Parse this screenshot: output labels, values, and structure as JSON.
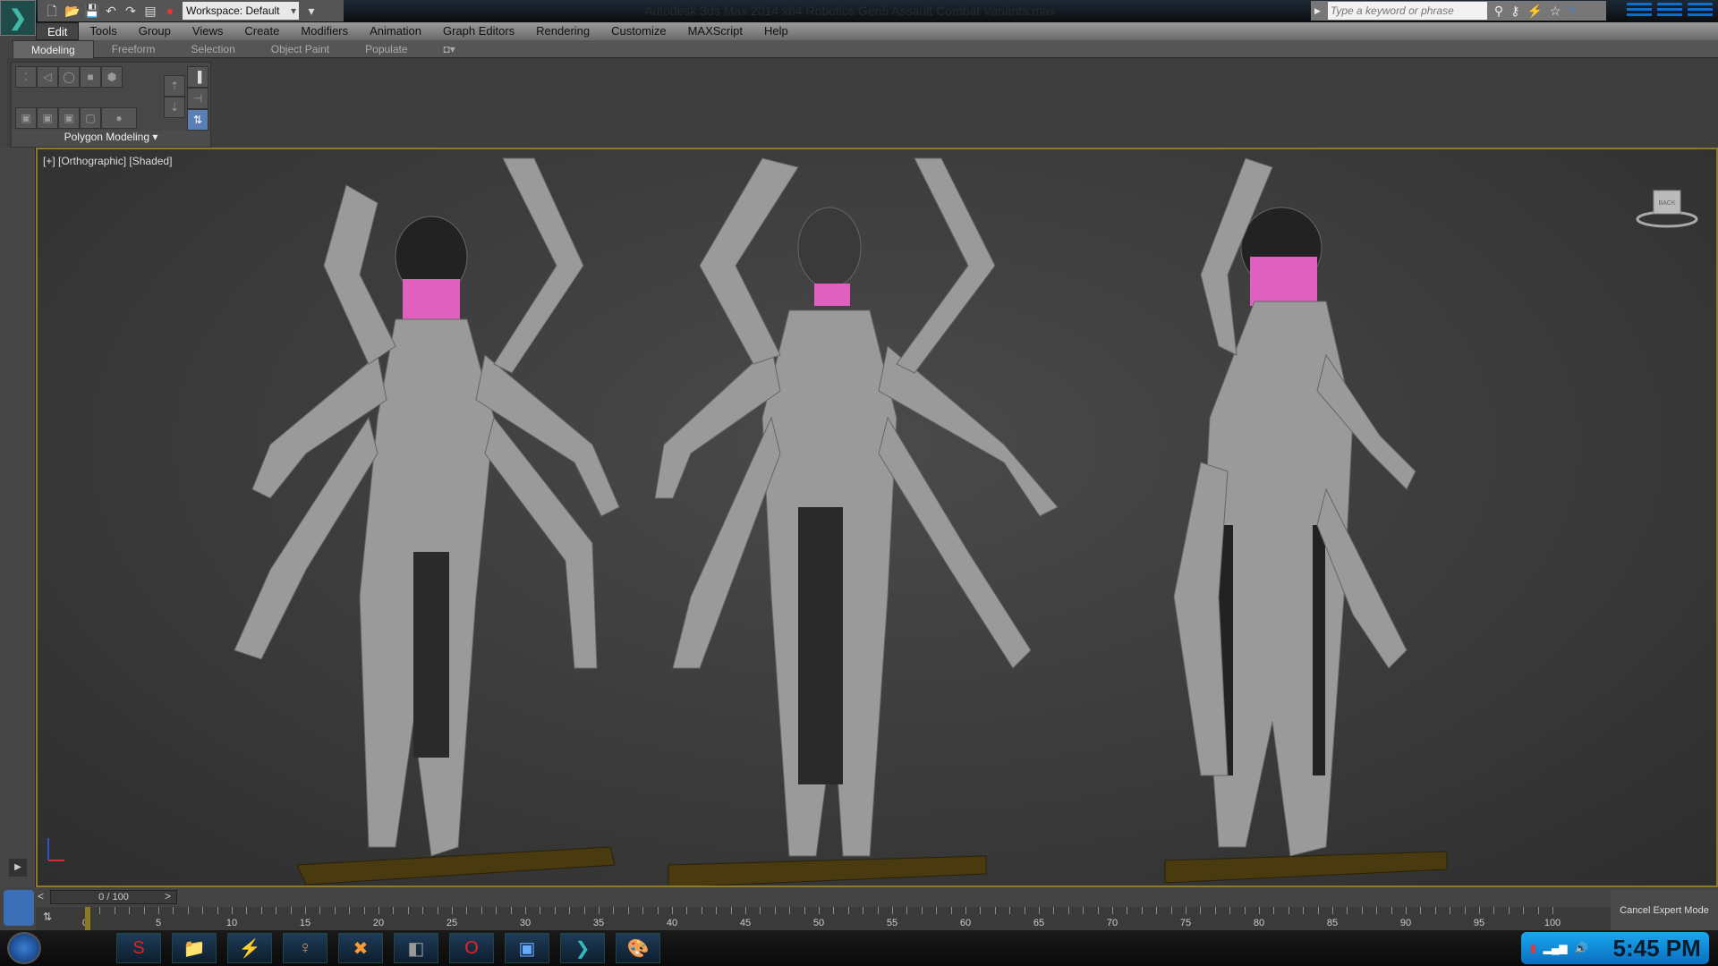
{
  "titlebar": {
    "title": "Autodesk 3ds Max  2014 x64      Robotics Gen5 Assault Combat Variants.max",
    "workspace": "Workspace: Default"
  },
  "quick_access": [
    "new-icon",
    "open-icon",
    "save-icon",
    "undo-icon",
    "redo-icon",
    "project-icon",
    "sketchfab-icon"
  ],
  "search": {
    "placeholder": "Type a keyword or phrase",
    "icons": [
      "binoculars-icon",
      "key-icon",
      "satellite-icon",
      "star-icon",
      "help-icon"
    ]
  },
  "menu": [
    "Edit",
    "Tools",
    "Group",
    "Views",
    "Create",
    "Modifiers",
    "Animation",
    "Graph Editors",
    "Rendering",
    "Customize",
    "MAXScript",
    "Help"
  ],
  "ribbon": {
    "tabs": [
      "Modeling",
      "Freeform",
      "Selection",
      "Object Paint",
      "Populate"
    ],
    "active_tab": "Modeling",
    "panel_label": "Polygon Modeling"
  },
  "viewport": {
    "label": "[+] [Orthographic] [Shaded]",
    "viewcube_label": "BACK"
  },
  "timeline": {
    "frame_display": "0 / 100",
    "prev": "<",
    "next": ">",
    "ticks": [
      "0",
      "5",
      "10",
      "15",
      "20",
      "25",
      "30",
      "35",
      "40",
      "45",
      "50",
      "55",
      "60",
      "65",
      "70",
      "75",
      "80",
      "85",
      "90",
      "95",
      "100"
    ]
  },
  "status": {
    "cancel_expert": "Cancel Expert Mode"
  },
  "taskbar": {
    "apps": [
      "shadow-app-icon",
      "file-explorer-icon",
      "thunder-app-icon",
      "tomb-raider-icon",
      "x-app-icon",
      "nvidia-icon",
      "opera-icon",
      "photo-viewer-icon",
      "3ds-max-icon",
      "paint-icon"
    ],
    "clock": "5:45 PM"
  },
  "colors": {
    "viewport_border": "#8a7a30",
    "accent": "#0c6fd0",
    "base": "#4a3a10",
    "hair": "#e060c0"
  }
}
